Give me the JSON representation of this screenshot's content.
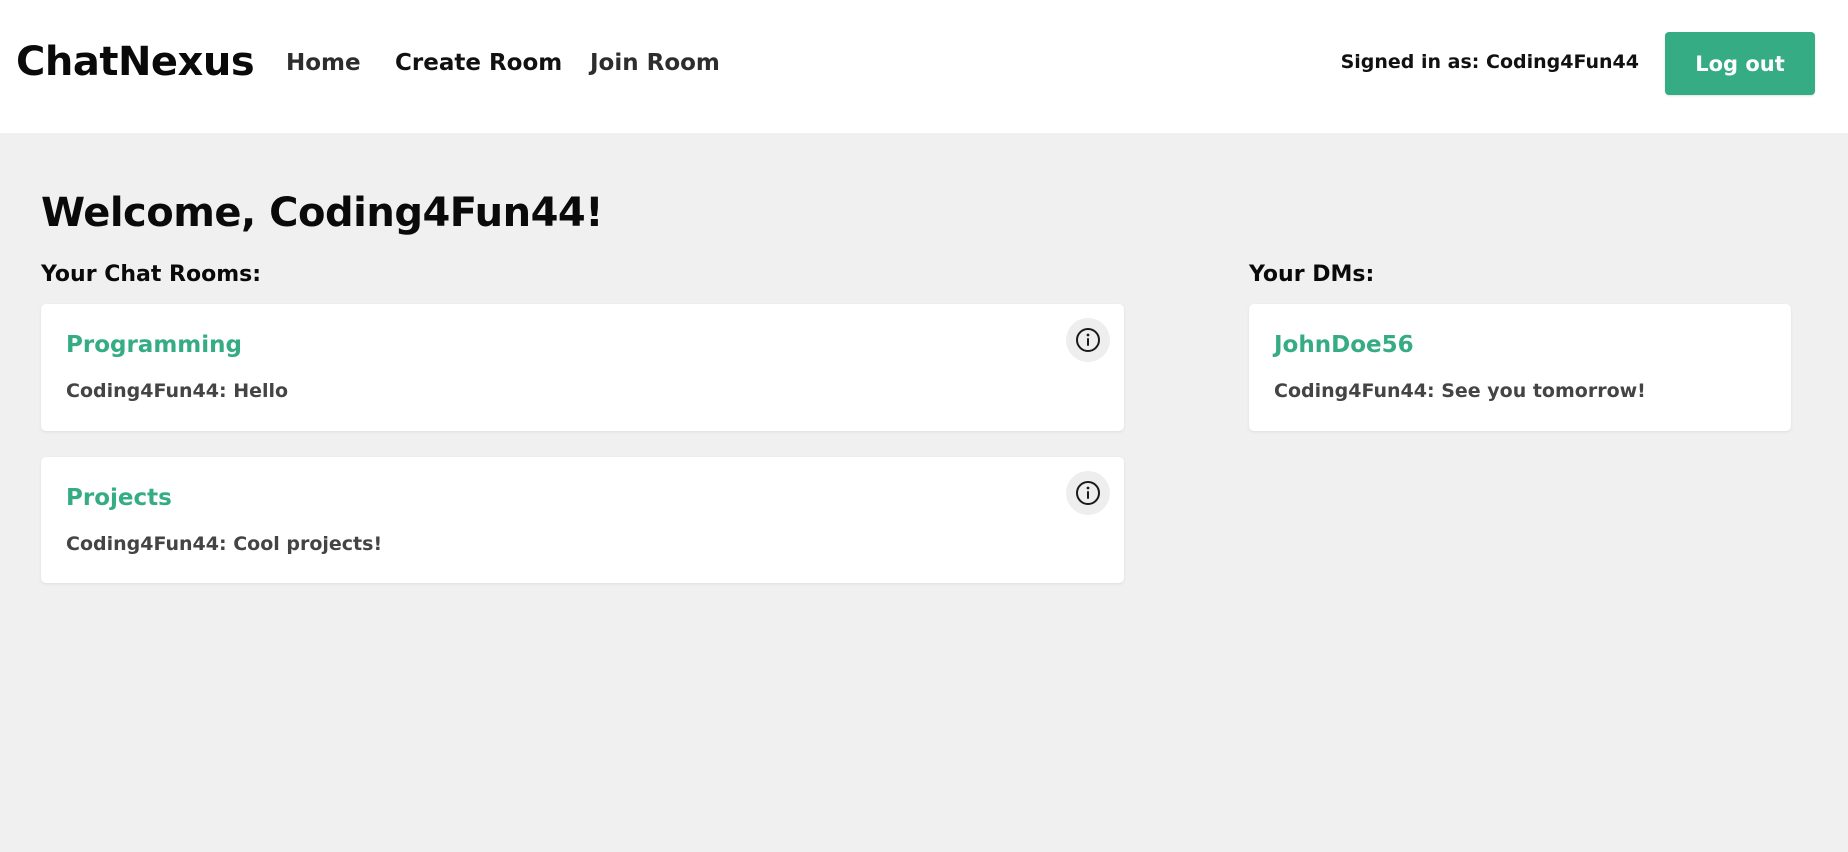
{
  "navbar": {
    "brand": "ChatNexus",
    "links": {
      "home": "Home",
      "create_room": "Create Room",
      "join_room": "Join Room"
    },
    "signed_in_text": "Signed in as: Coding4Fun44",
    "logout_label": "Log out"
  },
  "main": {
    "welcome": "Welcome, Coding4Fun44!",
    "rooms_heading": "Your Chat Rooms:",
    "dms_heading": "Your DMs:",
    "rooms": [
      {
        "name": "Programming",
        "last_message": "Coding4Fun44: Hello",
        "icon": "info-icon"
      },
      {
        "name": "Projects",
        "last_message": "Coding4Fun44: Cool projects!",
        "icon": "info-icon"
      }
    ],
    "dms": [
      {
        "name": "JohnDoe56",
        "last_message": "Coding4Fun44: See you tomorrow!"
      }
    ]
  },
  "colors": {
    "accent": "#35ac83",
    "page_background": "#f0f0f0",
    "card_background": "#ffffff",
    "message_text": "#444444"
  }
}
